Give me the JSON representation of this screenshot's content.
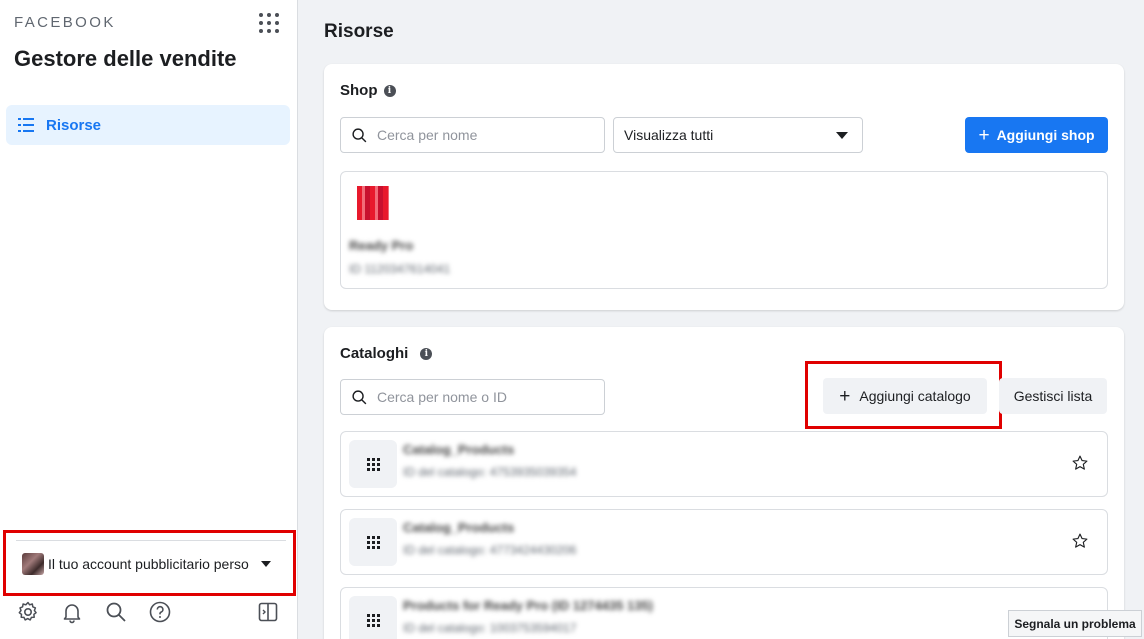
{
  "sidebar": {
    "brand": "FACEBOOK",
    "title": "Gestore delle vendite",
    "nav": [
      {
        "label": "Risorse",
        "icon": "list-icon"
      }
    ],
    "account": {
      "label": "Il tuo account pubblicitario perso"
    },
    "footer_icons": [
      "gear-icon",
      "bell-icon",
      "search-icon",
      "help-icon",
      "panel-toggle-icon"
    ]
  },
  "main": {
    "title": "Risorse",
    "shop": {
      "title": "Shop",
      "search_placeholder": "Cerca per nome",
      "filter_value": "Visualizza tutti",
      "add_button": "Aggiungi shop",
      "items": [
        {
          "name": "Ready Pro",
          "id": "ID 1120347614041"
        }
      ]
    },
    "catalogs": {
      "title": "Cataloghi",
      "search_placeholder": "Cerca per nome o ID",
      "add_button": "Aggiungi catalogo",
      "manage_button": "Gestisci lista",
      "items": [
        {
          "name": "Catalog_Products",
          "id": "ID del catalogo: 4753935039354"
        },
        {
          "name": "Catalog_Products",
          "id": "ID del catalogo: 4773424430206"
        },
        {
          "name": "Products for Ready Pro (ID 1274435 135)",
          "id": "ID del catalogo: 1003753594017"
        }
      ]
    }
  },
  "report_button": "Segnala un problema",
  "colors": {
    "accent": "#1877f2",
    "highlight": "#e00000",
    "background": "#f0f2f5"
  }
}
